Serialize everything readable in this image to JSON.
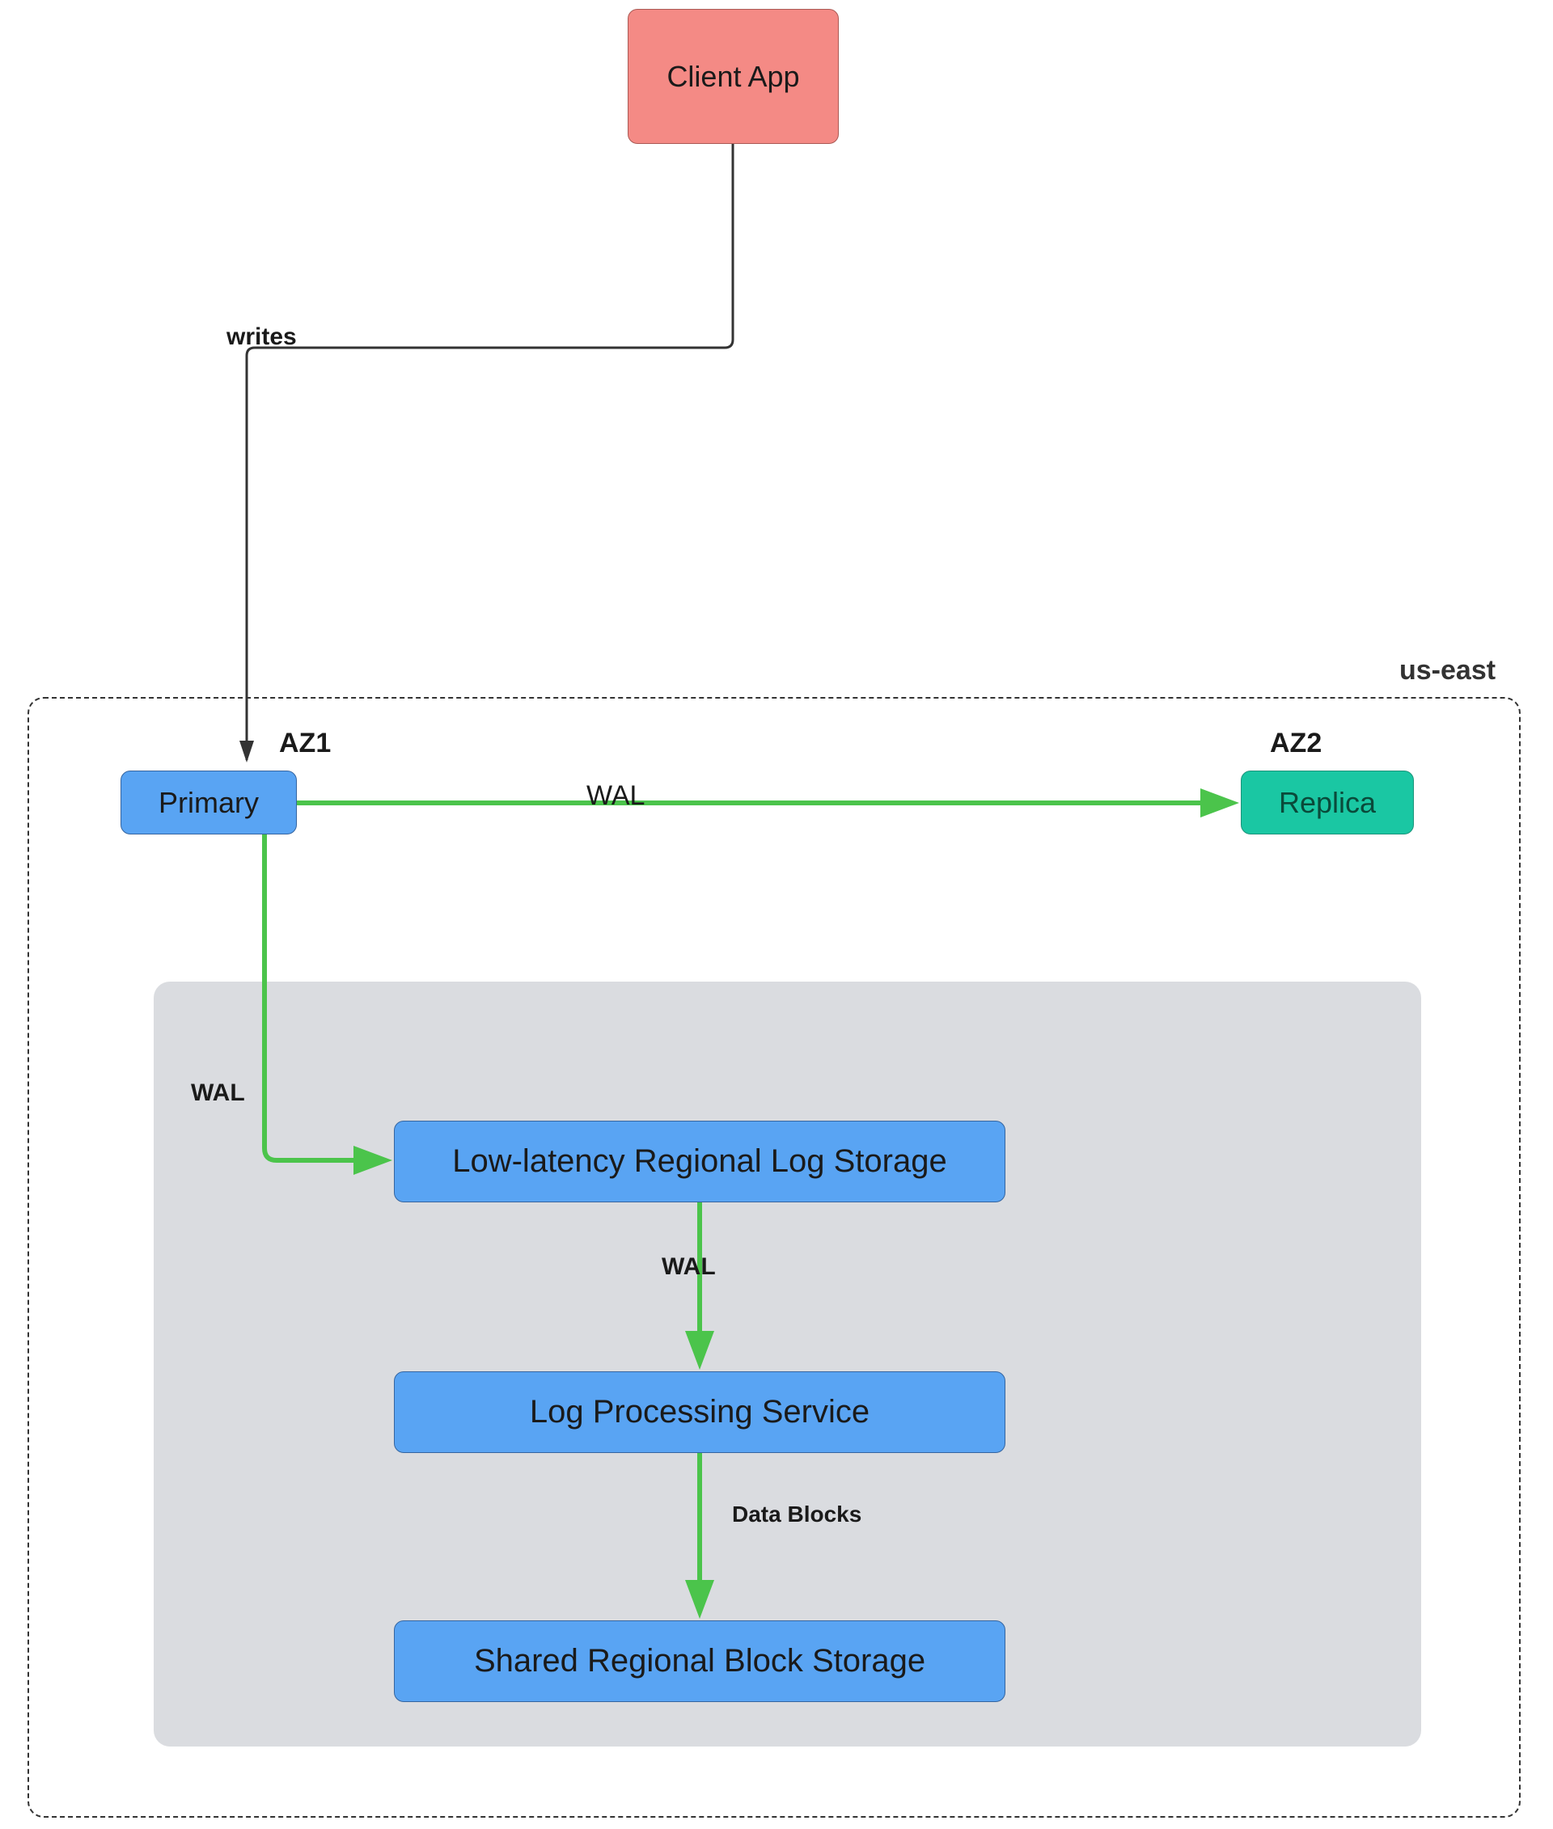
{
  "diagram": {
    "region_label": "us-east",
    "az1_label": "AZ1",
    "az2_label": "AZ2",
    "nodes": {
      "client": "Client App",
      "primary": "Primary",
      "replica": "Replica",
      "log_storage": "Low-latency Regional Log Storage",
      "log_processing": "Log Processing Service",
      "block_storage": "Shared Regional Block Storage"
    },
    "edges": {
      "client_to_primary": "writes",
      "primary_to_replica": "WAL",
      "primary_to_log_storage": "WAL",
      "log_storage_to_processing": "WAL",
      "processing_to_block": "Data Blocks"
    },
    "colors": {
      "client_fill": "#f48a85",
      "primary_fill": "#59a4f3",
      "storage_fill": "#59a4f3",
      "replica_fill": "#1ac7a3",
      "green_arrow": "#4bc44b",
      "dark_arrow": "#333333",
      "inner_box": "#dadce0"
    }
  }
}
